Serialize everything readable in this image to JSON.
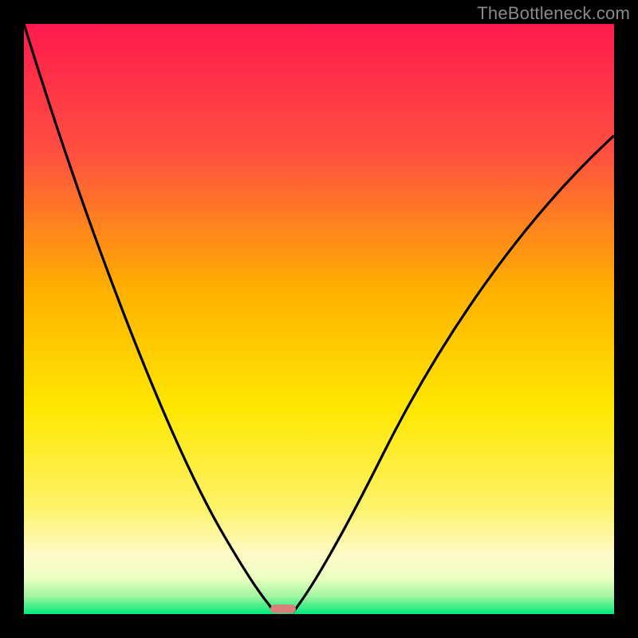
{
  "watermark": "TheBottleneck.com",
  "chart_data": {
    "type": "line",
    "title": "",
    "xlabel": "",
    "ylabel": "",
    "xlim": [
      0,
      100
    ],
    "ylim": [
      0,
      100
    ],
    "grid": false,
    "background_gradient": {
      "top": "#ff1a4d",
      "mid_upper": "#ffb000",
      "mid": "#ffe700",
      "mid_lower": "#fff9c0",
      "bottom": "#00e878"
    },
    "series": [
      {
        "name": "left-curve",
        "x": [
          0,
          5,
          10,
          15,
          20,
          25,
          30,
          35,
          38,
          40,
          41.5,
          42.5
        ],
        "y": [
          100,
          88,
          77,
          66,
          55,
          44,
          33,
          22,
          13,
          6,
          2,
          0
        ]
      },
      {
        "name": "right-curve",
        "x": [
          45.5,
          47,
          50,
          55,
          60,
          65,
          70,
          75,
          80,
          85,
          90,
          95,
          100
        ],
        "y": [
          0,
          2,
          7,
          17,
          27,
          37,
          46,
          54,
          61,
          67,
          72,
          77,
          81
        ]
      }
    ],
    "minimum_marker": {
      "x_start": 42,
      "x_end": 46,
      "y": 0,
      "color": "#d9807a"
    }
  }
}
